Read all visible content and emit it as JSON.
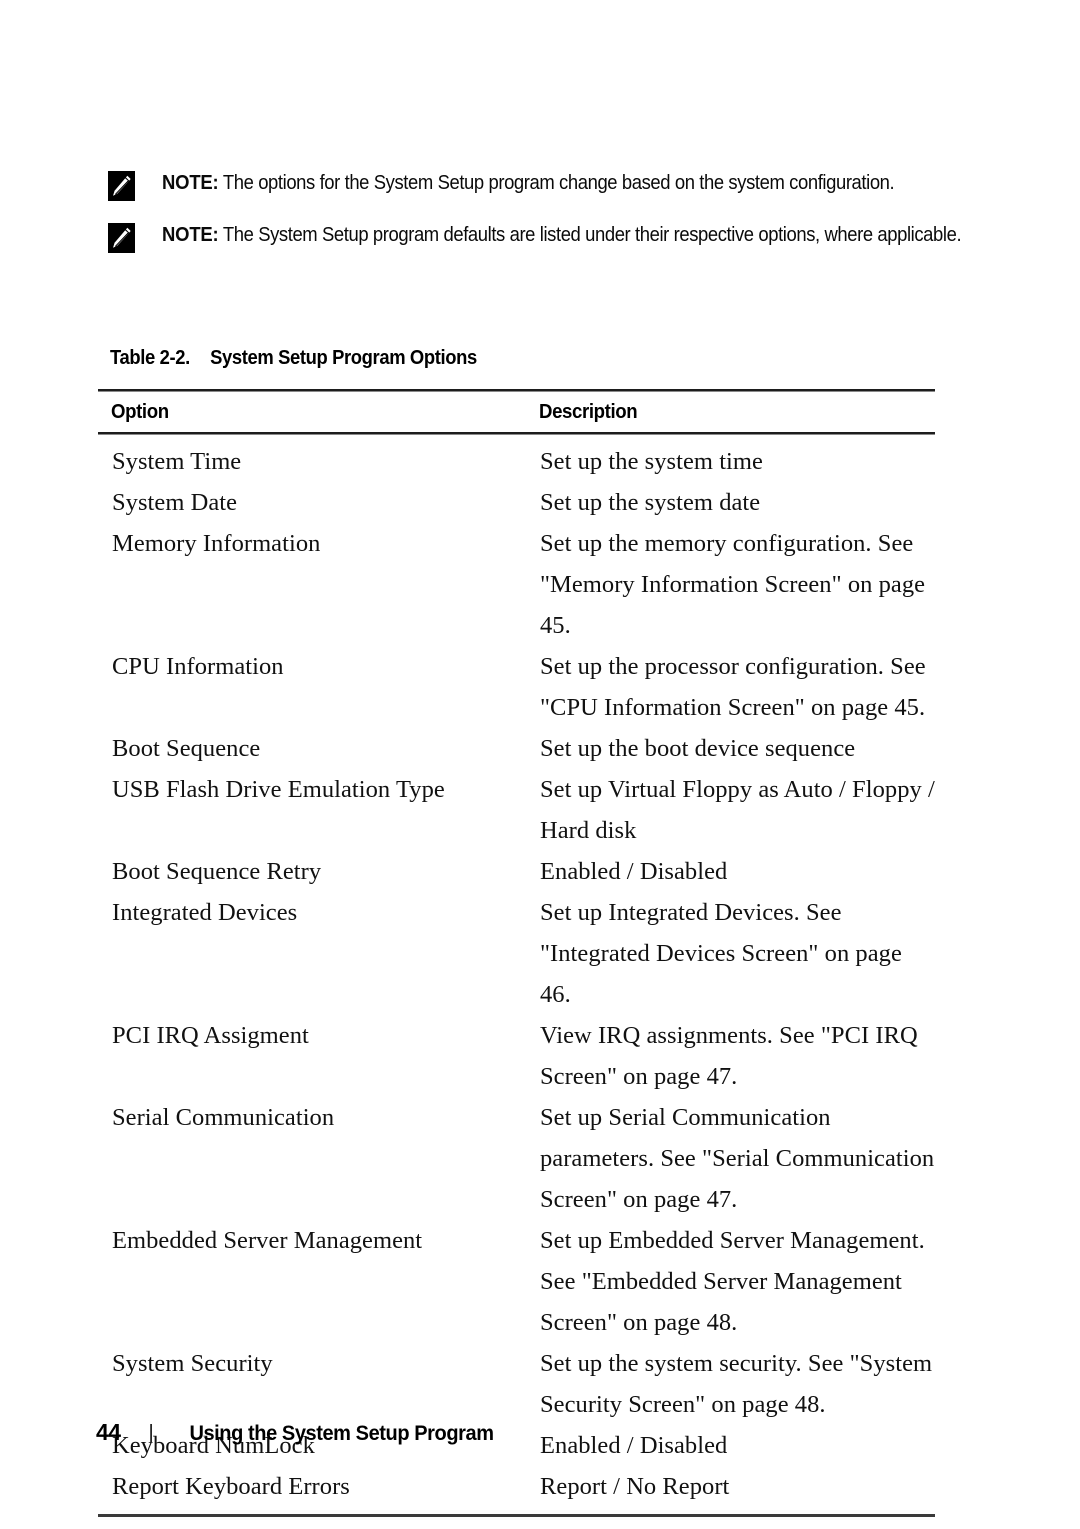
{
  "document": {
    "page_number": "44",
    "footer_title": "Using the System Setup Program"
  },
  "notes": [
    {
      "icon": "note-pencil-icon",
      "label": "NOTE:",
      "text": " The options for the System Setup program change based on the system configuration."
    },
    {
      "icon": "note-pencil-icon",
      "label": "NOTE:",
      "text": " The System Setup program defaults are listed under their respective options, where applicable."
    }
  ],
  "table": {
    "caption_number": "Table 2-2.",
    "caption_title": "System Setup Program Options",
    "columns": [
      "Option",
      "Description"
    ],
    "rows": [
      {
        "option": "System Time",
        "description": "Set up the system time"
      },
      {
        "option": "System Date",
        "description": "Set up the system date"
      },
      {
        "option": "Memory Information",
        "description": "Set up the memory configuration. See \"Memory Information Screen\" on page 45."
      },
      {
        "option": "CPU Information",
        "description": "Set up the processor configuration. See \"CPU Information Screen\" on page 45."
      },
      {
        "option": "Boot Sequence",
        "description": "Set up the boot device sequence"
      },
      {
        "option": "USB Flash Drive Emulation Type",
        "description": "Set up Virtual Floppy as Auto / Floppy / Hard disk"
      },
      {
        "option": "Boot Sequence Retry",
        "description": "Enabled / Disabled"
      },
      {
        "option": "Integrated Devices",
        "description": "Set up Integrated Devices. See \"Integrated Devices Screen\" on page 46."
      },
      {
        "option": "PCI IRQ Assigment",
        "description": "View IRQ assignments. See \"PCI IRQ Screen\" on page 47."
      },
      {
        "option": "Serial Communication",
        "description": "Set up Serial Communication parameters. See \"Serial Communication Screen\" on page 47."
      },
      {
        "option": "Embedded Server Management",
        "description": "Set up Embedded Server Management. See \"Embedded Server Management Screen\" on page 48."
      },
      {
        "option": "System Security",
        "description": "Set up the system security. See \"System Security Screen\" on page 48."
      },
      {
        "option": "Keyboard NumLock",
        "description": "Enabled / Disabled"
      },
      {
        "option": "Report Keyboard Errors",
        "description": "Report / No Report"
      }
    ]
  },
  "colors": {
    "text": "#111111",
    "rule": "#1d1d1d",
    "rule_light": "#8a8a8a",
    "icon_bg": "#000000",
    "page_bg": "#ffffff"
  }
}
